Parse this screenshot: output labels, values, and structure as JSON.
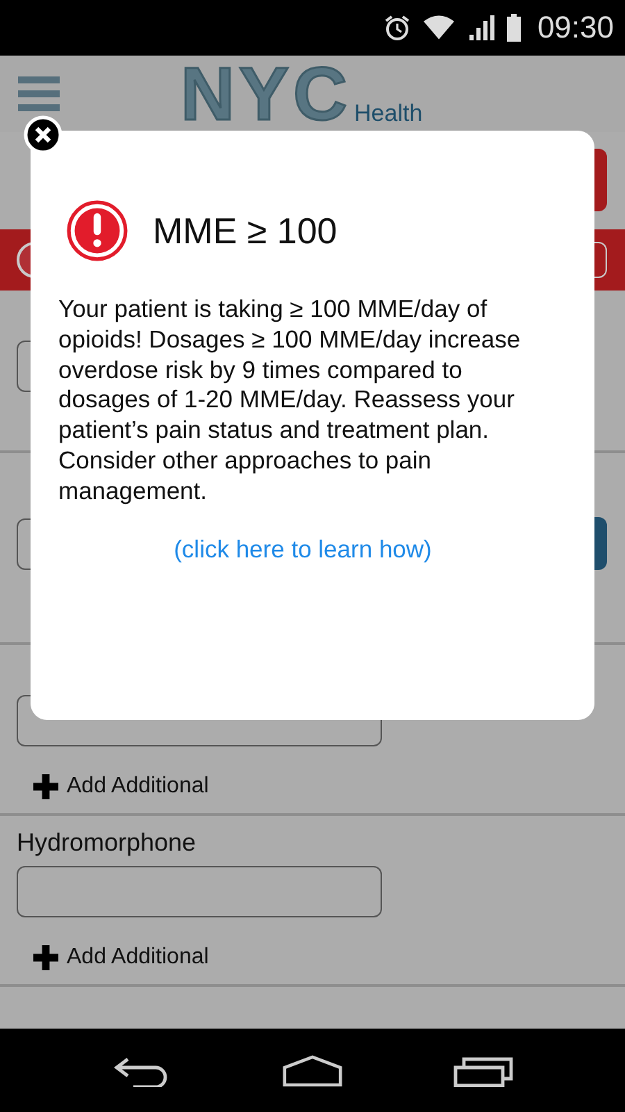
{
  "status_bar": {
    "time": "09:30"
  },
  "header": {
    "logo": "NYC",
    "logo_subtitle": "Health"
  },
  "page": {
    "sections": [
      {
        "has_side_button": false
      },
      {
        "has_side_button": true
      },
      {
        "has_side_button": false,
        "add_label": "Add Additional"
      },
      {
        "label": "Hydromorphone",
        "has_side_button": false,
        "add_label": "Add Additional"
      }
    ]
  },
  "dialog": {
    "title": "MME ≥ 100",
    "message": "Your patient is taking ≥ 100 MME/day of opioids! Dosages ≥ 100 MME/day increase overdose risk by 9 times compared to dosages of 1-20 MME/day. Reassess your patient’s pain status and treatment plan. Consider other approaches to pain management.",
    "link": "(click here to learn how)"
  }
}
